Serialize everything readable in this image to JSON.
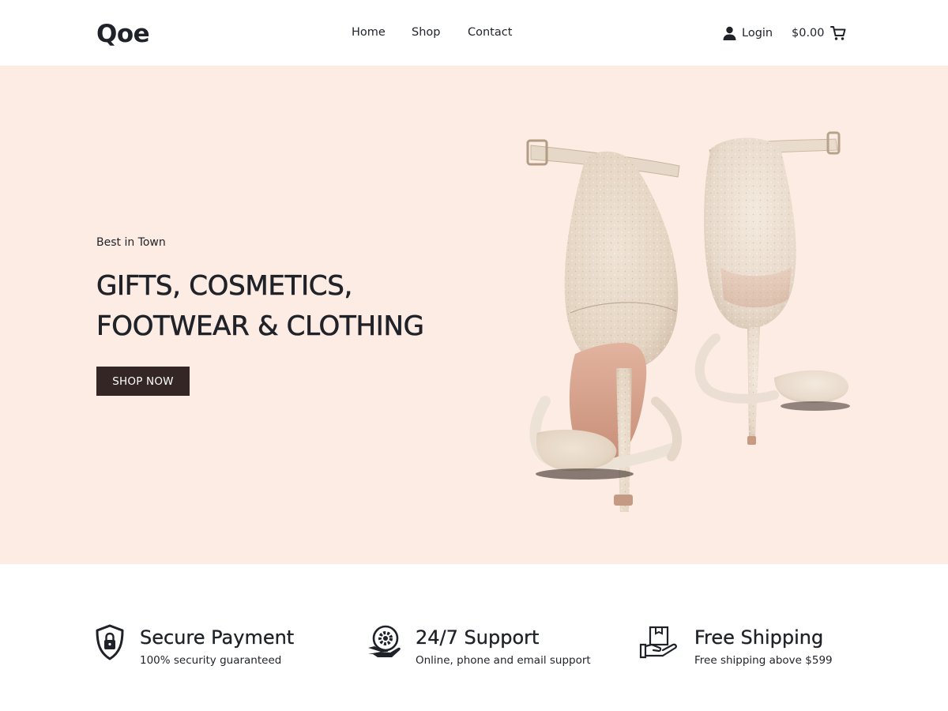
{
  "header": {
    "logo": "Qoe",
    "nav": [
      {
        "label": "Home"
      },
      {
        "label": "Shop"
      },
      {
        "label": "Contact"
      }
    ],
    "login_label": "Login",
    "cart_total": "$0.00",
    "icons": {
      "login": "user-icon",
      "cart": "cart-icon"
    }
  },
  "hero": {
    "tagline": "Best in Town",
    "headline_line1": "GIFTS, COSMETICS,",
    "headline_line2": "FOOTWEAR & CLOTHING",
    "cta_label": "SHOP NOW",
    "image": "high-heel-sandals-image"
  },
  "features": [
    {
      "title": "Secure Payment",
      "subtitle": "100% security guaranteed",
      "icon": "shield-lock-icon"
    },
    {
      "title": "24/7 Support",
      "subtitle": "Online, phone and email support",
      "icon": "support-gear-hand-icon"
    },
    {
      "title": "Free Shipping",
      "subtitle": "Free shipping above $599",
      "icon": "hand-box-icon"
    }
  ],
  "colors": {
    "hero_background": "#fcece3",
    "button_background": "#332624",
    "text": "#1f2228"
  }
}
